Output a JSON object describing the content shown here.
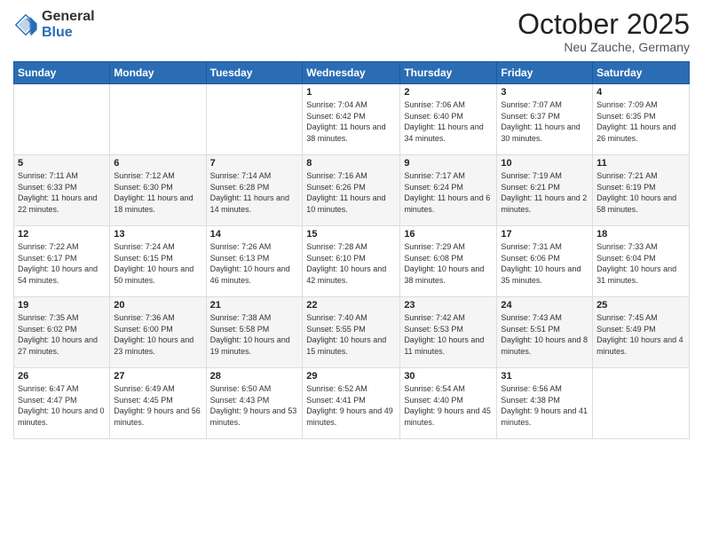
{
  "header": {
    "logo_general": "General",
    "logo_blue": "Blue",
    "month_title": "October 2025",
    "subtitle": "Neu Zauche, Germany"
  },
  "days_of_week": [
    "Sunday",
    "Monday",
    "Tuesday",
    "Wednesday",
    "Thursday",
    "Friday",
    "Saturday"
  ],
  "weeks": [
    [
      {
        "day": "",
        "info": ""
      },
      {
        "day": "",
        "info": ""
      },
      {
        "day": "",
        "info": ""
      },
      {
        "day": "1",
        "info": "Sunrise: 7:04 AM\nSunset: 6:42 PM\nDaylight: 11 hours and 38 minutes."
      },
      {
        "day": "2",
        "info": "Sunrise: 7:06 AM\nSunset: 6:40 PM\nDaylight: 11 hours and 34 minutes."
      },
      {
        "day": "3",
        "info": "Sunrise: 7:07 AM\nSunset: 6:37 PM\nDaylight: 11 hours and 30 minutes."
      },
      {
        "day": "4",
        "info": "Sunrise: 7:09 AM\nSunset: 6:35 PM\nDaylight: 11 hours and 26 minutes."
      }
    ],
    [
      {
        "day": "5",
        "info": "Sunrise: 7:11 AM\nSunset: 6:33 PM\nDaylight: 11 hours and 22 minutes."
      },
      {
        "day": "6",
        "info": "Sunrise: 7:12 AM\nSunset: 6:30 PM\nDaylight: 11 hours and 18 minutes."
      },
      {
        "day": "7",
        "info": "Sunrise: 7:14 AM\nSunset: 6:28 PM\nDaylight: 11 hours and 14 minutes."
      },
      {
        "day": "8",
        "info": "Sunrise: 7:16 AM\nSunset: 6:26 PM\nDaylight: 11 hours and 10 minutes."
      },
      {
        "day": "9",
        "info": "Sunrise: 7:17 AM\nSunset: 6:24 PM\nDaylight: 11 hours and 6 minutes."
      },
      {
        "day": "10",
        "info": "Sunrise: 7:19 AM\nSunset: 6:21 PM\nDaylight: 11 hours and 2 minutes."
      },
      {
        "day": "11",
        "info": "Sunrise: 7:21 AM\nSunset: 6:19 PM\nDaylight: 10 hours and 58 minutes."
      }
    ],
    [
      {
        "day": "12",
        "info": "Sunrise: 7:22 AM\nSunset: 6:17 PM\nDaylight: 10 hours and 54 minutes."
      },
      {
        "day": "13",
        "info": "Sunrise: 7:24 AM\nSunset: 6:15 PM\nDaylight: 10 hours and 50 minutes."
      },
      {
        "day": "14",
        "info": "Sunrise: 7:26 AM\nSunset: 6:13 PM\nDaylight: 10 hours and 46 minutes."
      },
      {
        "day": "15",
        "info": "Sunrise: 7:28 AM\nSunset: 6:10 PM\nDaylight: 10 hours and 42 minutes."
      },
      {
        "day": "16",
        "info": "Sunrise: 7:29 AM\nSunset: 6:08 PM\nDaylight: 10 hours and 38 minutes."
      },
      {
        "day": "17",
        "info": "Sunrise: 7:31 AM\nSunset: 6:06 PM\nDaylight: 10 hours and 35 minutes."
      },
      {
        "day": "18",
        "info": "Sunrise: 7:33 AM\nSunset: 6:04 PM\nDaylight: 10 hours and 31 minutes."
      }
    ],
    [
      {
        "day": "19",
        "info": "Sunrise: 7:35 AM\nSunset: 6:02 PM\nDaylight: 10 hours and 27 minutes."
      },
      {
        "day": "20",
        "info": "Sunrise: 7:36 AM\nSunset: 6:00 PM\nDaylight: 10 hours and 23 minutes."
      },
      {
        "day": "21",
        "info": "Sunrise: 7:38 AM\nSunset: 5:58 PM\nDaylight: 10 hours and 19 minutes."
      },
      {
        "day": "22",
        "info": "Sunrise: 7:40 AM\nSunset: 5:55 PM\nDaylight: 10 hours and 15 minutes."
      },
      {
        "day": "23",
        "info": "Sunrise: 7:42 AM\nSunset: 5:53 PM\nDaylight: 10 hours and 11 minutes."
      },
      {
        "day": "24",
        "info": "Sunrise: 7:43 AM\nSunset: 5:51 PM\nDaylight: 10 hours and 8 minutes."
      },
      {
        "day": "25",
        "info": "Sunrise: 7:45 AM\nSunset: 5:49 PM\nDaylight: 10 hours and 4 minutes."
      }
    ],
    [
      {
        "day": "26",
        "info": "Sunrise: 6:47 AM\nSunset: 4:47 PM\nDaylight: 10 hours and 0 minutes."
      },
      {
        "day": "27",
        "info": "Sunrise: 6:49 AM\nSunset: 4:45 PM\nDaylight: 9 hours and 56 minutes."
      },
      {
        "day": "28",
        "info": "Sunrise: 6:50 AM\nSunset: 4:43 PM\nDaylight: 9 hours and 53 minutes."
      },
      {
        "day": "29",
        "info": "Sunrise: 6:52 AM\nSunset: 4:41 PM\nDaylight: 9 hours and 49 minutes."
      },
      {
        "day": "30",
        "info": "Sunrise: 6:54 AM\nSunset: 4:40 PM\nDaylight: 9 hours and 45 minutes."
      },
      {
        "day": "31",
        "info": "Sunrise: 6:56 AM\nSunset: 4:38 PM\nDaylight: 9 hours and 41 minutes."
      },
      {
        "day": "",
        "info": ""
      }
    ]
  ]
}
